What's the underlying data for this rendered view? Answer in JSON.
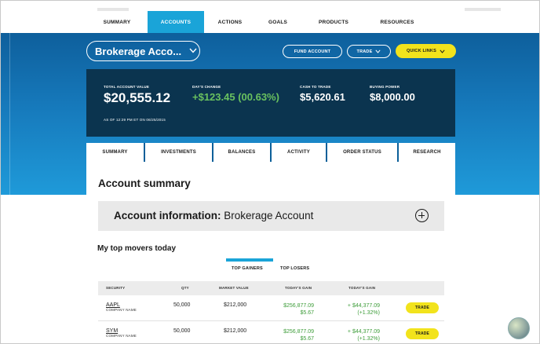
{
  "topnav": {
    "items": [
      "SUMMARY",
      "ACCOUNTS",
      "ACTIONS",
      "GOALS",
      "PRODUCTS",
      "RESOURCES"
    ],
    "active_index": 1
  },
  "account_selector": {
    "label": "Brokerage Acco...",
    "icon": "chevron-down-icon"
  },
  "header_buttons": {
    "fund": "FUND ACCOUNT",
    "trade": "TRADE",
    "quick_links": "QUICK LINKS"
  },
  "summary": {
    "total_label": "TOTAL ACCOUNT VALUE",
    "total_value": "$20,555.12",
    "change_label": "DAY'S CHANGE",
    "change_value": "+$123.45 (00.63%)",
    "cash_label": "CASH TO TRADE",
    "cash_value": "$5,620.61",
    "power_label": "BUYING POWER",
    "power_value": "$8,000.00",
    "as_of": "AS OF 12:29 PM ET ON 06/25/2015"
  },
  "tabs": [
    "SUMMARY",
    "INVESTMENTS",
    "BALANCES",
    "ACTIVITY",
    "ORDER STATUS",
    "RESEARCH"
  ],
  "content": {
    "heading": "Account summary",
    "info_bold": "Account information:",
    "info_rest": " Brokerage Account",
    "movers_heading": "My top movers today",
    "subtabs": [
      "TOP GAINERS",
      "TOP LOSERS"
    ],
    "table_headers": [
      "SECURITY",
      "QTY",
      "MARKET VALUE",
      "TODAY'S GAIN",
      "TODAY'S GAIN"
    ],
    "rows": [
      {
        "symbol": "AAPL",
        "company": "COMPANY NAME",
        "qty": "50,000",
        "market_value": "$212,000",
        "gain1_line1": "$256,877.09",
        "gain1_line2": "$5.67",
        "gain2_line1": "+ $44,377.09",
        "gain2_line2": "(+1.32%)",
        "action": "TRADE"
      },
      {
        "symbol": "SYM",
        "company": "COMPANY NAME",
        "qty": "50,000",
        "market_value": "$212,000",
        "gain1_line1": "$256,877.09",
        "gain1_line2": "$5.67",
        "gain2_line1": "+ $44,377.09",
        "gain2_line2": "(+1.32%)",
        "action": "TRADE"
      }
    ]
  },
  "colors": {
    "accent": "#1aa4d8",
    "panel": "#0b344f",
    "gain": "#69c15f",
    "button_yellow": "#f2e31c"
  }
}
